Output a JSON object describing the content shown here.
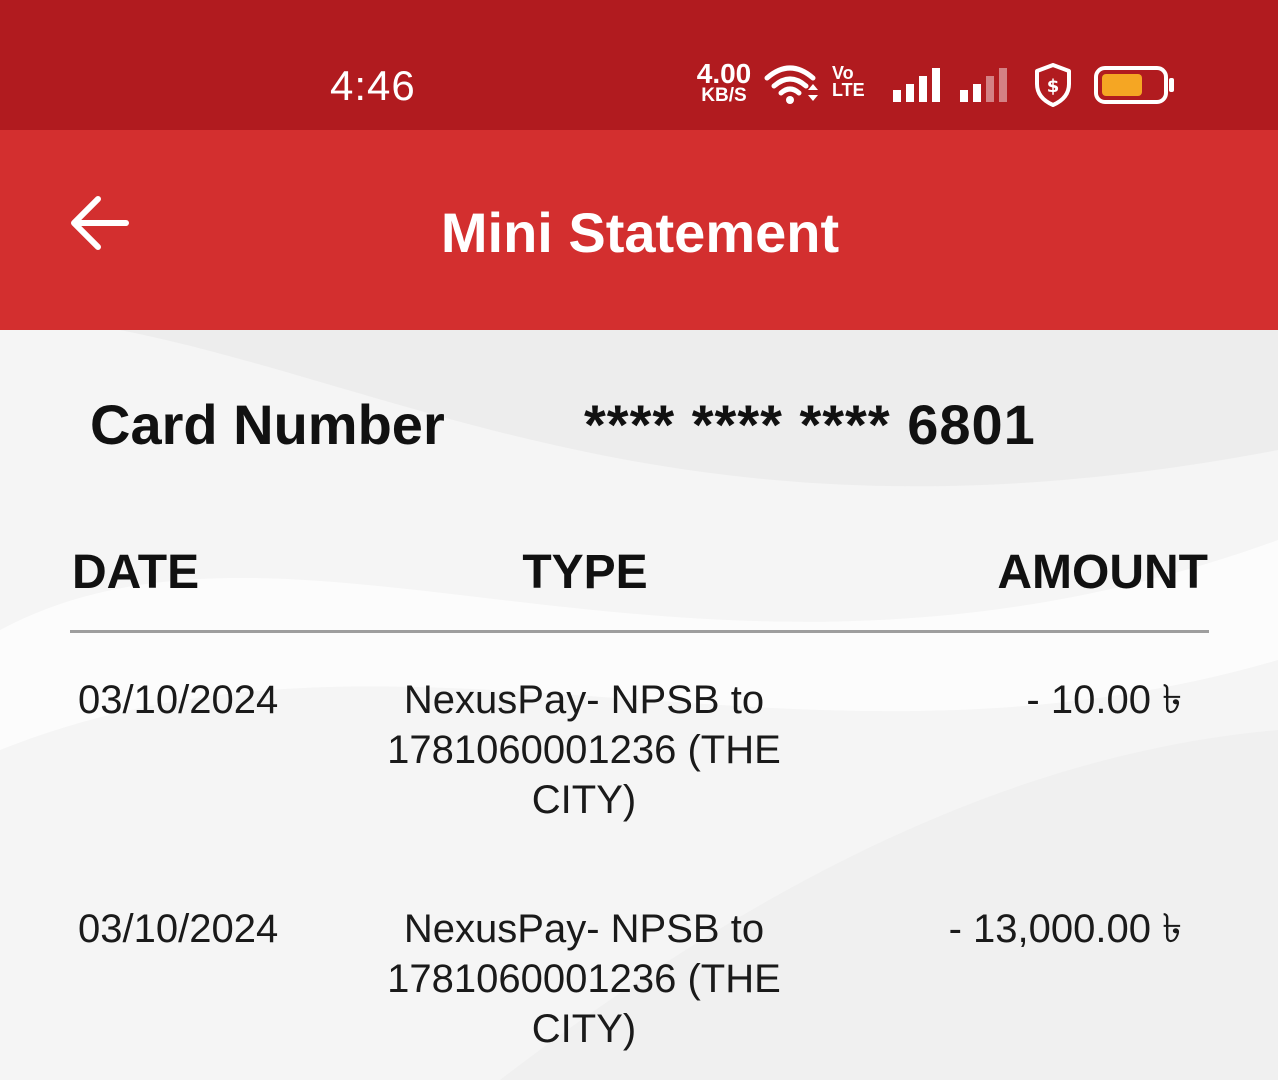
{
  "status_bar": {
    "time": "4:46",
    "net_speed_value": "4.00",
    "net_speed_unit": "KB/S",
    "volte_top": "Vo",
    "volte_bottom": "LTE",
    "battery_color": "#f5a623",
    "icons": [
      "wifi-icon",
      "volte-icon",
      "signal-icon",
      "signal-weak-icon",
      "security-shield-icon",
      "battery-icon"
    ]
  },
  "app_bar": {
    "title": "Mini Statement",
    "back_icon": "back-arrow-icon",
    "color": "#d32f2f"
  },
  "card": {
    "label": "Card Number",
    "number": "**** **** **** 6801"
  },
  "table": {
    "headers": {
      "date": "DATE",
      "type": "TYPE",
      "amount": "AMOUNT"
    },
    "rows": [
      {
        "date": "03/10/2024",
        "type": "NexusPay- NPSB to 1781060001236 (THE CITY)",
        "amount": "- 10.00 ৳"
      },
      {
        "date": "03/10/2024",
        "type": "NexusPay- NPSB to 1781060001236 (THE CITY)",
        "amount": "- 13,000.00 ৳"
      }
    ]
  }
}
